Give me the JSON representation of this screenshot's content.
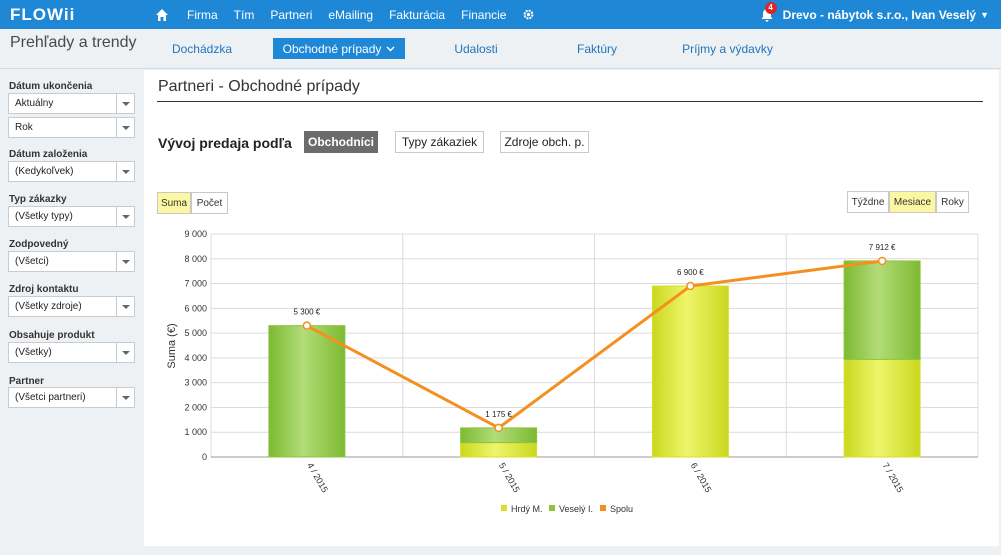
{
  "app": {
    "logo": "FLOWii",
    "nav": [
      "Firma",
      "Tím",
      "Partneri",
      "eMailing",
      "Fakturácia",
      "Financie"
    ],
    "notification_count": "4",
    "user": "Drevo - nábytok s.r.o., Ivan Veselý"
  },
  "subheader": {
    "section_title": "Prehľady a trendy",
    "tabs": [
      "Dochádzka",
      "Obchodné prípady",
      "Udalosti",
      "Faktúry",
      "Príjmy a výdavky"
    ],
    "active_tab": "Obchodné prípady"
  },
  "filters": [
    {
      "label": "Dátum ukončenia",
      "values": [
        "Aktuálny",
        "Rok"
      ]
    },
    {
      "label": "Dátum založenia",
      "values": [
        "(Kedykoľvek)"
      ]
    },
    {
      "label": "Typ zákazky",
      "values": [
        "(Všetky typy)"
      ]
    },
    {
      "label": "Zodpovedný",
      "values": [
        "(Všetci)"
      ]
    },
    {
      "label": "Zdroj kontaktu",
      "values": [
        "(Všetky zdroje)"
      ]
    },
    {
      "label": "Obsahuje produkt",
      "values": [
        "(Všetky)"
      ]
    },
    {
      "label": "Partner",
      "values": [
        "(Všetci partneri)"
      ]
    }
  ],
  "main": {
    "title": "Partneri - Obchodné prípady",
    "vyvoj_label": "Vývoj predaja podľa",
    "group_buttons": [
      "Obchodníci",
      "Typy zákaziek",
      "Zdroje obch. p."
    ],
    "active_group": "Obchodníci",
    "measure_toggle": [
      "Suma",
      "Počet"
    ],
    "active_measure": "Suma",
    "period_toggle": [
      "Týždne",
      "Mesiace",
      "Roky"
    ],
    "active_period": "Mesiace"
  },
  "colors": {
    "brand_blue": "#1e88d6",
    "series_hrdy": "#d8e02a",
    "series_vesely": "#8cc43c",
    "series_spolu": "#f39020",
    "toggle_on": "#fbf7a3"
  },
  "chart_data": {
    "type": "bar",
    "stacked": true,
    "categories": [
      "4 / 2015",
      "5 / 2015",
      "6 / 2015",
      "7 / 2015"
    ],
    "series": [
      {
        "name": "Hrdý M.",
        "type": "bar",
        "values": [
          0,
          580,
          6900,
          3940
        ]
      },
      {
        "name": "Veselý I.",
        "type": "bar",
        "values": [
          5300,
          595,
          0,
          3972
        ]
      },
      {
        "name": "Spolu",
        "type": "line",
        "values": [
          5300,
          1175,
          6900,
          7912
        ]
      }
    ],
    "total_labels": [
      "5 300 €",
      "1 175 €",
      "6 900 €",
      "7 912 €"
    ],
    "ylabel": "Suma (€)",
    "ylim": [
      0,
      9000
    ],
    "yticks": [
      0,
      1000,
      2000,
      3000,
      4000,
      5000,
      6000,
      7000,
      8000,
      9000
    ],
    "ytick_labels": [
      "0",
      "1 000",
      "2 000",
      "3 000",
      "4 000",
      "5 000",
      "6 000",
      "7 000",
      "8 000",
      "9 000"
    ],
    "grid": true,
    "legend_position": "bottom"
  }
}
